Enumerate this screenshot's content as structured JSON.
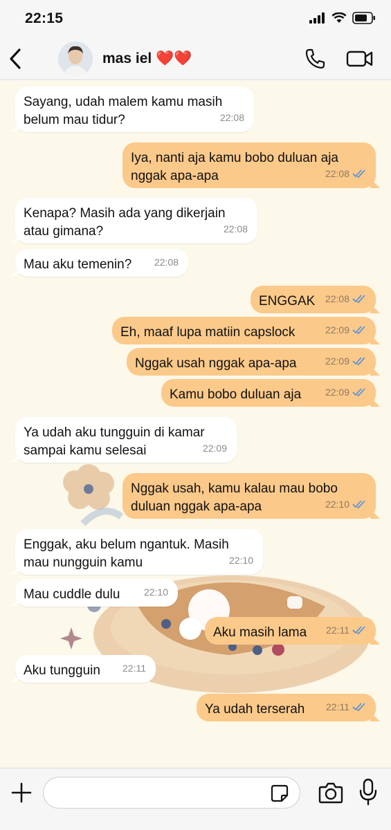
{
  "status_bar": {
    "time": "22:15"
  },
  "header": {
    "contact_name": "mas iel ❤️❤️"
  },
  "colors": {
    "incoming": "#ffffff",
    "outgoing": "#fbc98a",
    "tick_read": "#4a8fe0",
    "chat_bg": "#fcf8ea"
  },
  "messages": [
    {
      "dir": "in",
      "text": "Sayang, udah malem kamu masih\nbelum mau tidur?",
      "time": "22:08"
    },
    {
      "dir": "out",
      "text": "Iya, nanti aja kamu bobo duluan aja\nnggak apa-apa",
      "time": "22:08"
    },
    {
      "dir": "in",
      "text": "Kenapa? Masih ada yang dikerjain\natau gimana?",
      "time": "22:08"
    },
    {
      "dir": "in",
      "text": "Mau aku temenin?",
      "time": "22:08"
    },
    {
      "dir": "out",
      "text": "ENGGAK",
      "time": "22:08"
    },
    {
      "dir": "out",
      "text": "Eh, maaf lupa matiin capslock",
      "time": "22:09"
    },
    {
      "dir": "out",
      "text": "Nggak usah nggak apa-apa",
      "time": "22:09"
    },
    {
      "dir": "out",
      "text": "Kamu bobo duluan aja",
      "time": "22:09"
    },
    {
      "dir": "in",
      "text": "Ya udah aku tungguin di kamar\nsampai kamu selesai",
      "time": "22:09"
    },
    {
      "dir": "out",
      "text": "Nggak usah, kamu kalau mau bobo\nduluan nggak apa-apa",
      "time": "22:10"
    },
    {
      "dir": "in",
      "text": "Enggak, aku belum ngantuk. Masih\nmau nungguin kamu",
      "time": "22:10"
    },
    {
      "dir": "in",
      "text": "Mau cuddle dulu",
      "time": "22:10"
    },
    {
      "dir": "out",
      "text": "Aku masih lama",
      "time": "22:11"
    },
    {
      "dir": "in",
      "text": "Aku tungguin",
      "time": "22:11"
    },
    {
      "dir": "out",
      "text": "Ya udah terserah",
      "time": "22:11"
    }
  ],
  "input": {
    "placeholder": ""
  }
}
